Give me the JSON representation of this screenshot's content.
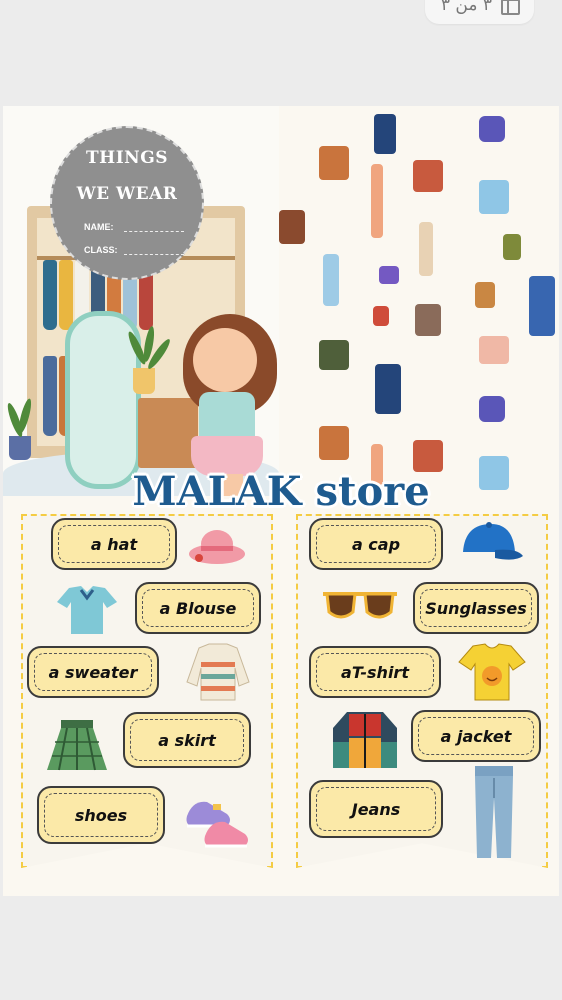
{
  "page_indicator": {
    "text": "٣ من ٣"
  },
  "cover": {
    "title_line1": "THINGS",
    "title_line2": "WE WEAR",
    "field_name": "NAME:",
    "field_class": "CLASS:"
  },
  "banner": {
    "text": "MALAK store"
  },
  "left_cards": [
    "a hat",
    "a Blouse",
    "a sweater",
    "a skirt",
    "shoes"
  ],
  "right_cards": [
    "a cap",
    "Sunglasses",
    "aT-shirt",
    "a jacket",
    "Jeans"
  ],
  "icons": {
    "left": [
      "hat-icon",
      "blouse-icon",
      "sweater-icon",
      "skirt-icon",
      "shoes-icon"
    ],
    "right": [
      "cap-icon",
      "sunglasses-icon",
      "tshirt-icon",
      "jacket-icon",
      "jeans-icon"
    ]
  },
  "colors": {
    "card_fill": "#fbe9a8",
    "banner_text": "#1e5b8f",
    "panel_border": "#f4cc43"
  }
}
